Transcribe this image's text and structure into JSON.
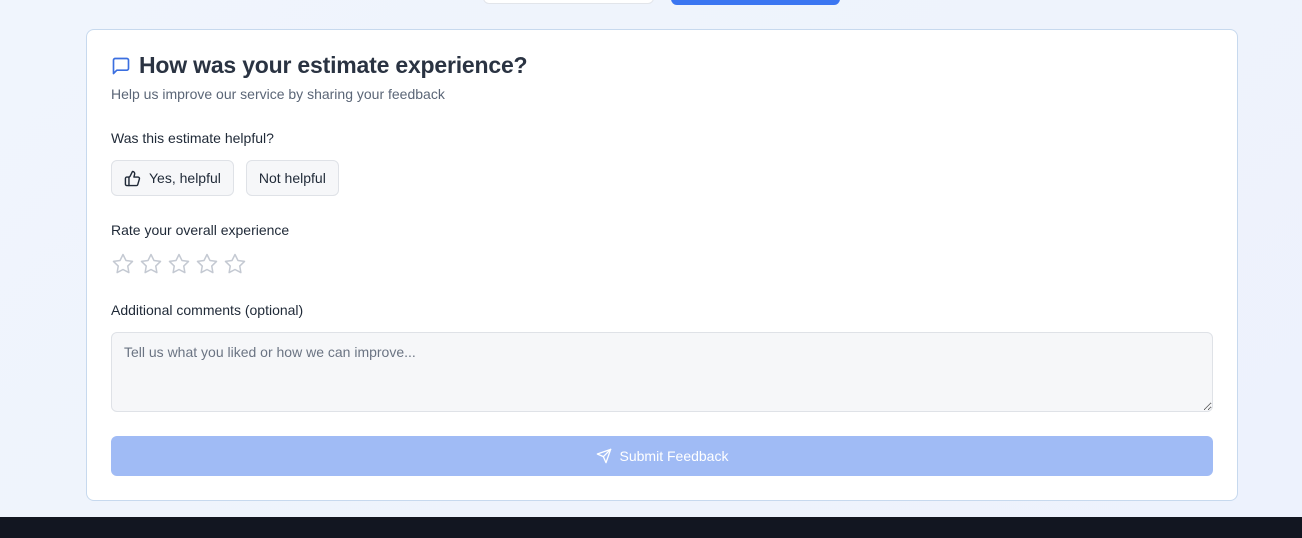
{
  "feedback": {
    "title": "How was your estimate experience?",
    "subtitle": "Help us improve our service by sharing your feedback",
    "helpful_question": "Was this estimate helpful?",
    "yes_label": "Yes, helpful",
    "no_label": "Not helpful",
    "rating_label": "Rate your overall experience",
    "rating": {
      "value": 0,
      "max": 5
    },
    "comments_label": "Additional comments (optional)",
    "comments_value": "",
    "comments_placeholder": "Tell us what you liked or how we can improve...",
    "submit_label": "Submit Feedback"
  },
  "icons": {
    "header": "message-square-icon",
    "yes": "thumbs-up-icon",
    "rating": "star-icon",
    "submit": "send-icon"
  },
  "colors": {
    "accent": "#3b76f1",
    "accent_icon": "#3b6fe0",
    "submit_disabled": "#a0bbf5",
    "card_border": "#c7d9ee",
    "star_outline": "#c4c9d2",
    "footer": "#121621"
  }
}
